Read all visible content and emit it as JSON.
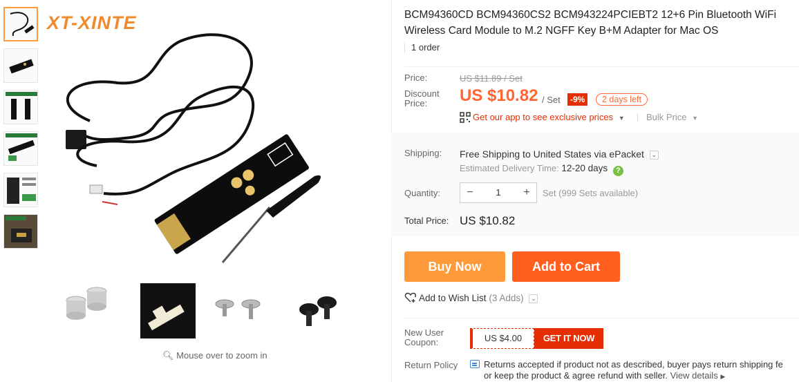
{
  "brand": "XT-XINTE",
  "product": {
    "title": "BCM94360CD BCM94360CS2 BCM943224PCIEBT2 12+6 Pin Bluetooth WiFi Wireless Card Module to M.2 NGFF Key B+M Adapter for Mac OS",
    "orders": "1 order"
  },
  "price": {
    "label": "Price:",
    "original": "US $11.89 / Set",
    "discount_label": "Discount Price:",
    "discount": "US $10.82",
    "unit": "/ Set",
    "badge": "-9%",
    "time_left": "2 days left",
    "app_link": "Get our app to see exclusive prices",
    "bulk": "Bulk Price"
  },
  "shipping": {
    "label": "Shipping:",
    "value": "Free Shipping to United States via ePacket",
    "delivery_label": "Estimated Delivery Time:",
    "delivery_value": "12-20 days"
  },
  "quantity": {
    "label": "Quantity:",
    "value": "1",
    "minus": "−",
    "plus": "+",
    "stock": "Set (999 Sets available)"
  },
  "total": {
    "label": "Total Price:",
    "value": "US $10.82"
  },
  "actions": {
    "buy_now": "Buy Now",
    "add_to_cart": "Add to Cart",
    "wishlist": "Add to Wish List",
    "wishlist_count": "(3 Adds)"
  },
  "coupon": {
    "label": "New User Coupon:",
    "amount": "US $4.00",
    "cta": "GET IT NOW"
  },
  "returns": {
    "label": "Return Policy",
    "line1": "Returns accepted if product not as described, buyer pays return shipping fe",
    "line2": "or keep the product & agree refund with seller.",
    "link": "View details"
  },
  "zoom_hint": "Mouse over to zoom in",
  "colors": {
    "accent_orange": "#ff6020",
    "buy_orange": "#ff9a3a",
    "price_red": "#ff6633",
    "badge_red": "#e62e04"
  }
}
